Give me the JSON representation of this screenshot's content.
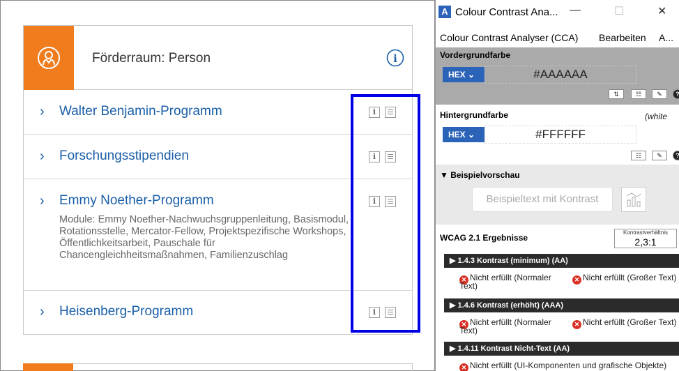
{
  "website": {
    "header_title": "Förderraum: Person",
    "items": [
      {
        "title": "Walter Benjamin-Programm",
        "subtitle": ""
      },
      {
        "title": "Forschungsstipendien",
        "subtitle": ""
      },
      {
        "title": "Emmy Noether-Programm",
        "subtitle": "Module: Emmy Noether-Nachwuchsgruppenleitung, Basismodul, Rotationsstelle, Mercator-Fellow, Projektspezifische Workshops, Öffentlichkeitsarbeit, Pauschale für Chancengleichheitsmaßnahmen, Familienzuschlag"
      },
      {
        "title": "Heisenberg-Programm",
        "subtitle": ""
      }
    ],
    "accent_orange": "#f07c1e",
    "link_blue": "#1a5fa8",
    "highlight_blue": "#0000e6"
  },
  "cca": {
    "window_title": "Colour Contrast Ana...",
    "menu": [
      "Colour Contrast Analyser (CCA)",
      "Bearbeiten",
      "A..."
    ],
    "foreground": {
      "label": "Vordergrundfarbe",
      "format": "HEX",
      "value": "#AAAAAA"
    },
    "background": {
      "label": "Hintergrundfarbe",
      "name": "(white",
      "format": "HEX",
      "value": "#FFFFFF"
    },
    "preview": {
      "label": "▼ Beispielvorschau",
      "sample_text": "Beispieltext mit Kontrast"
    },
    "wcag": {
      "label": "WCAG 2.1 Ergebnisse",
      "ratio_label": "Kontrastverhältnis",
      "ratio_value": "2,3:1",
      "criteria": [
        {
          "title": "▶ 1.4.3 Kontrast (minimum) (AA)",
          "result_normal": "Nicht erfüllt (Normaler",
          "result_normal_2": "Text)",
          "result_large": "Nicht erfüllt (Großer Text)"
        },
        {
          "title": "▶ 1.4.6 Kontrast (erhöht) (AAA)",
          "result_normal": "Nicht erfüllt (Normaler",
          "result_normal_2": "Text)",
          "result_large": "Nicht erfüllt (Großer Text)"
        },
        {
          "title": "▶ 1.4.11 Kontrast Nicht-Text (AA)",
          "result_ui": "Nicht erfüllt (UI-Komponenten und grafische Objekte)"
        }
      ]
    },
    "colors": {
      "foreground": "#aaaaaa",
      "hex_button": "#2b63b8",
      "fail": "#d93025"
    }
  }
}
